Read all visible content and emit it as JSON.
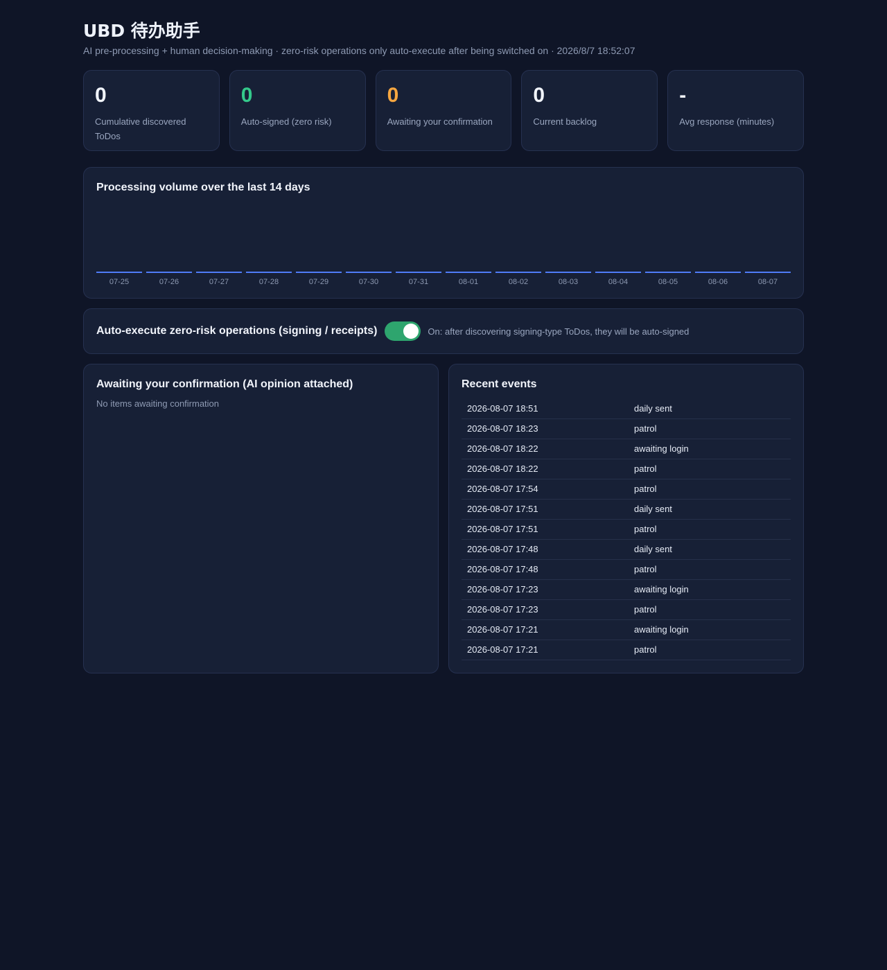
{
  "header": {
    "title": "UBD 待办助手",
    "subtitle": "AI pre-processing + human decision-making · zero-risk operations only auto-execute after being switched on · 2026/8/7 18:52:07"
  },
  "stats": [
    {
      "value": "0",
      "label": "Cumulative discovered ToDos",
      "color": "#f1f4fb"
    },
    {
      "value": "0",
      "label": "Auto-signed (zero risk)",
      "color": "#34c98b"
    },
    {
      "value": "0",
      "label": "Awaiting your confirmation",
      "color": "#f5a640"
    },
    {
      "value": "0",
      "label": "Current backlog",
      "color": "#f1f4fb"
    },
    {
      "value": "-",
      "label": "Avg response (minutes)",
      "color": "#f1f4fb"
    }
  ],
  "chart_data": {
    "type": "bar",
    "title": "Processing volume over the last 14 days",
    "categories": [
      "07-25",
      "07-26",
      "07-27",
      "07-28",
      "07-29",
      "07-30",
      "07-31",
      "08-01",
      "08-02",
      "08-03",
      "08-04",
      "08-05",
      "08-06",
      "08-07"
    ],
    "values": [
      0,
      0,
      0,
      0,
      0,
      0,
      0,
      0,
      0,
      0,
      0,
      0,
      0,
      0
    ],
    "bar_color": "#4f7cf7"
  },
  "auto_execute": {
    "label": "Auto-execute zero-risk operations (signing / receipts)",
    "enabled": true,
    "hint": "On: after discovering signing-type ToDos, they will be auto-signed"
  },
  "confirmations": {
    "title": "Awaiting your confirmation (AI opinion attached)",
    "empty_text": "No items awaiting confirmation"
  },
  "events": {
    "title": "Recent events",
    "rows": [
      {
        "time": "2026-08-07 18:51",
        "event": "daily sent"
      },
      {
        "time": "2026-08-07 18:23",
        "event": "patrol"
      },
      {
        "time": "2026-08-07 18:22",
        "event": "awaiting login"
      },
      {
        "time": "2026-08-07 18:22",
        "event": "patrol"
      },
      {
        "time": "2026-08-07 17:54",
        "event": "patrol"
      },
      {
        "time": "2026-08-07 17:51",
        "event": "daily sent"
      },
      {
        "time": "2026-08-07 17:51",
        "event": "patrol"
      },
      {
        "time": "2026-08-07 17:48",
        "event": "daily sent"
      },
      {
        "time": "2026-08-07 17:48",
        "event": "patrol"
      },
      {
        "time": "2026-08-07 17:23",
        "event": "awaiting login"
      },
      {
        "time": "2026-08-07 17:23",
        "event": "patrol"
      },
      {
        "time": "2026-08-07 17:21",
        "event": "awaiting login"
      },
      {
        "time": "2026-08-07 17:21",
        "event": "patrol"
      }
    ]
  }
}
